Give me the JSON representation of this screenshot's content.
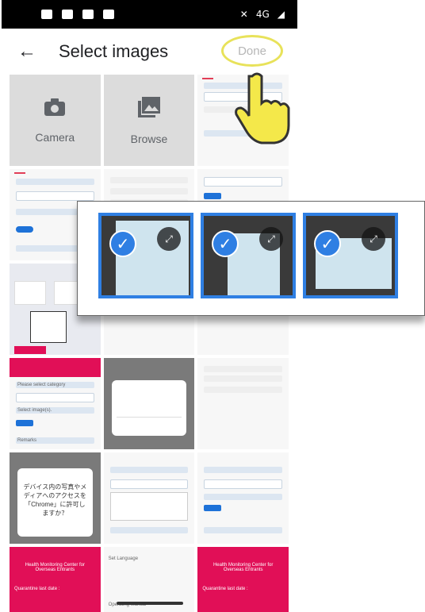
{
  "status_bar": {
    "network": "4G"
  },
  "app_bar": {
    "back_icon": "arrow-left-icon",
    "title": "Select images",
    "done_label": "Done"
  },
  "picker": {
    "camera_label": "Camera",
    "browse_label": "Browse"
  },
  "selected_images": [
    {
      "state": "selected",
      "icon": "check-icon",
      "expand_icon": "expand-icon"
    },
    {
      "state": "selected",
      "icon": "check-icon",
      "expand_icon": "expand-icon"
    },
    {
      "state": "selected",
      "icon": "check-icon",
      "expand_icon": "expand-icon"
    }
  ],
  "thumb_text": {
    "t1": "Please select category",
    "t2": "Select image(s).",
    "t3": "Remarks",
    "t4": "Health Monitoring Center for Overseas Entrants",
    "t5": "Quarantine last date :",
    "t6": "Set Language",
    "t7": "Operating Manual",
    "t8": "デバイス内の写真やメディアへのアクセスを「Chrome」に許可しますか？"
  }
}
